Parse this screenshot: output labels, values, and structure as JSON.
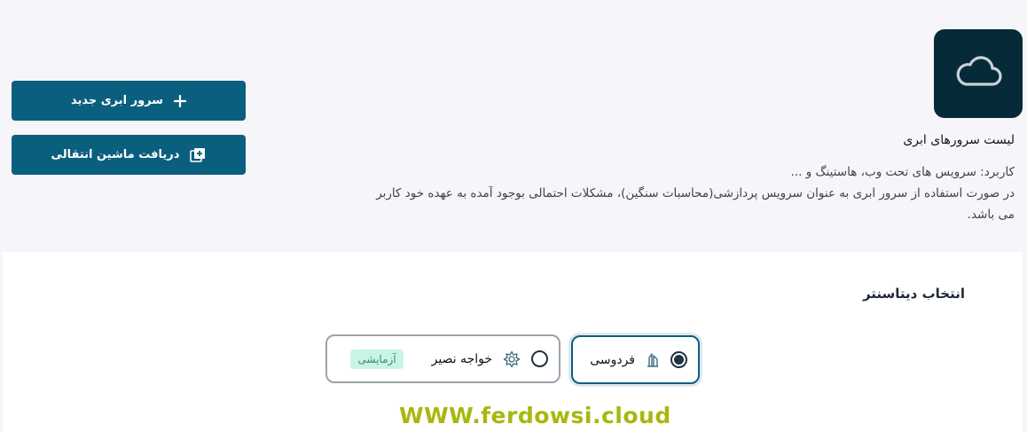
{
  "header": {
    "title": "لیست سرورهای ابری",
    "cloud_icon": "cloud-icon",
    "description_lines": [
      "کاربرد: سرویس های تحت وب، هاستینگ و ...",
      "در صورت استفاده از سرور ابری به عنوان سرویس پردازشی(محاسبات سنگین)، مشکلات احتمالی بوجود آمده به عهده خود کاربر",
      "می باشد."
    ]
  },
  "actions": {
    "new_server_label": "سرور ابری جدید",
    "new_server_icon": "plus-icon",
    "transfer_label": "دریافت ماشین انتقالی",
    "transfer_icon": "add-copy-icon"
  },
  "datacenter": {
    "section_title": "انتخاب دیتاسنتر",
    "options": [
      {
        "label": "فردوسی",
        "selected": true,
        "icon": "ferdowsi-icon"
      },
      {
        "label": "خواجه نصیر",
        "selected": false,
        "icon": "gear-flower-icon",
        "badge": "آزمایشی"
      }
    ]
  },
  "watermark": "WWW.ferdowsi.cloud",
  "colors": {
    "primary": "#0b5f7e",
    "tile": "#062a38",
    "badge_bg": "#c8f4e7",
    "watermark": "#a7b80f"
  }
}
